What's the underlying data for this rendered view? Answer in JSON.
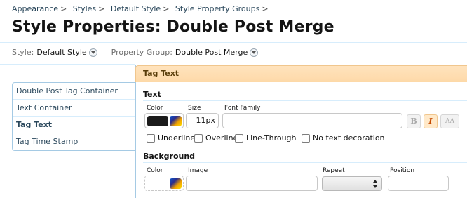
{
  "breadcrumb": [
    {
      "label": "Appearance"
    },
    {
      "label": "Styles"
    },
    {
      "label": "Default Style"
    },
    {
      "label": "Style Property Groups"
    }
  ],
  "breadcrumb_separator": ">",
  "page_title": "Style Properties: Double Post Merge",
  "selectors": {
    "style_label": "Style:",
    "style_value": "Default Style",
    "group_label": "Property Group:",
    "group_value": "Double Post Merge"
  },
  "sidebar": {
    "items": [
      {
        "label": "Double Post Tag Container",
        "active": false
      },
      {
        "label": "Text Container",
        "active": false
      },
      {
        "label": "Tag Text",
        "active": true
      },
      {
        "label": "Tag Time Stamp",
        "active": false
      }
    ]
  },
  "panel": {
    "title": "Tag Text",
    "text_section": {
      "title": "Text",
      "color_label": "Color",
      "color_value": "#1b1b1b",
      "size_label": "Size",
      "size_value": "11px",
      "font_family_label": "Font Family",
      "font_family_value": "",
      "format_buttons": [
        {
          "glyph": "B",
          "icon": "bold-icon",
          "active": false
        },
        {
          "glyph": "I",
          "icon": "italic-icon",
          "active": true
        },
        {
          "glyph": "AA",
          "icon": "small-caps-icon",
          "active": false
        }
      ],
      "decorations": [
        {
          "label": "Underline",
          "checked": false
        },
        {
          "label": "Overline",
          "checked": false
        },
        {
          "label": "Line-Through",
          "checked": false
        },
        {
          "label": "No text decoration",
          "checked": false
        }
      ]
    },
    "background_section": {
      "title": "Background",
      "color_label": "Color",
      "image_label": "Image",
      "image_value": "",
      "repeat_label": "Repeat",
      "repeat_value": "",
      "position_label": "Position",
      "position_value": ""
    }
  },
  "colors": {
    "link": "#2b485c",
    "header_bg": "#fdd9a8",
    "header_text": "#593d0a",
    "border": "#a5cae4",
    "italic_active": "#c54a00"
  }
}
